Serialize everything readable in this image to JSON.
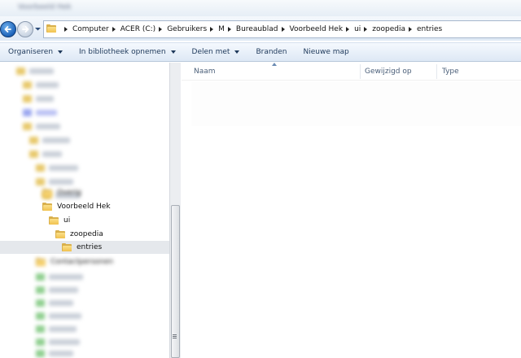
{
  "titlebar": {
    "text": "Voorbeeld Hek"
  },
  "breadcrumbs": [
    "Computer",
    "ACER (C:)",
    "Gebruikers",
    "M",
    "Bureaublad",
    "Voorbeeld Hek",
    "ui",
    "zoopedia",
    "entries"
  ],
  "commandbar": {
    "organize": "Organiseren",
    "library": "In bibliotheek opnemen",
    "share": "Delen met",
    "burn": "Branden",
    "newfolder": "Nieuwe map"
  },
  "navtree": {
    "item_above": "Overig",
    "voorbeeld": "Voorbeeld Hek",
    "ui": "ui",
    "zoopedia": "zoopedia",
    "entries": "entries",
    "contacts": "Contactpersonen"
  },
  "columns": {
    "name": "Naam",
    "modified": "Gewijzigd op",
    "type": "Type"
  },
  "colors": {
    "accent": "#1e395b",
    "folder": "#f1c24f"
  }
}
